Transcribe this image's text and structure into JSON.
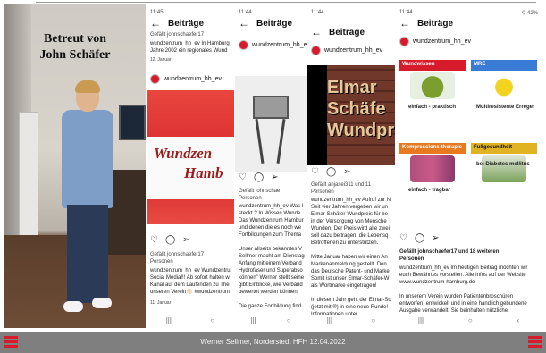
{
  "photo": {
    "caption_line1": "Betreut von",
    "caption_line2": "John Schäfer"
  },
  "phone1": {
    "status_time": "11:45",
    "title": "Beiträge",
    "liked_by": "Gefällt johnschaefer17",
    "account": "wundzentrum_hh_ev",
    "caption_line1": "wundzentrum_hh_ev In Hamburg",
    "caption_line2": "Jahre 2002 ein regionales Wund",
    "date": "12. Januar",
    "logo_line1": "Wundzen",
    "logo_line2": "Hamb",
    "liked_by2": "Gefällt johnschaefer17",
    "liked_by2b": "Personen",
    "text2": "wundzentrum_hh_ev Wundzentru\nSocial Media!!! Ab sofort halten w\nKanal auf dem Laufenden zu The\nunseren Verein👋🏻 #wundzentrum",
    "date2": "11. Januar"
  },
  "phone2": {
    "status_time": "11:44",
    "title": "Beiträge",
    "account": "wundzentrum_hh_ev",
    "liked_by": "Gefällt johnschae",
    "liked_by_b": "Personen",
    "text": "wundzentrum_hh_ev Was l\nsteckt ? In Wissen Wunde\nDas Wundzentrum Hambur\nund  denen die es noch we\nFortbildungen zum Thema\n\nUnser allseits bekanntes V\nSellmer macht am Dienstag\nAnfang mit einem Verband\nHydrofaser und Superabso\nkönnen\" Werner stellt seine\ngibt Einblicke, wie Verbänd\nbewertet werden können.\n\nDie ganze Fortbildung find"
  },
  "phone3": {
    "status_time": "11:44",
    "title": "Beiträge",
    "account": "wundzentrum_hh_ev",
    "image_word1": "Elmar",
    "image_word2": "Schäfe",
    "image_word3": "Wundpr",
    "liked_by": "Gefällt anjasei311 und 11",
    "liked_by_b": "Personen",
    "text": "wundzentrum_hh_ev Aufruf zur N\nSeit vier Jahren vergeben wir un\nElmar-Schäfer-Wundpreis für be\nin der Versorgung von Mensche\nWunden. Der Preis wird alle zwei\nsoll dazu beitragen, die Lebensq\nBetroffenen zu unterstützen.\n\nMitte Januar haben wir einen An\nMarkenanmeldung gestellt. Den\ndas Deutsche Patent- und Marke\nSomit ist unser Elmar-Schäfer-W\nals Wortmarke eingetragen!\n\nIn diesem Jahr geht der Elmar-Sc\n(jetzt mit ®) in eine neue Runde!\nInformationen unter"
  },
  "phone4": {
    "status_time": "11:44",
    "status_right": "⚲ 42%",
    "title": "Beiträge",
    "account": "wundzentrum_hh_ev",
    "tiles": [
      {
        "header": "Wundwissen",
        "caption": "einfach - praktisch"
      },
      {
        "header": "MRE",
        "caption": "Multiresistente Erreger"
      },
      {
        "header": "Kompressions-therapie",
        "caption": "einfach - tragbar"
      },
      {
        "header": "Fußgesundheit",
        "caption": "bei Diabetes mellitus"
      }
    ],
    "liked_by": "Gefällt johnschaefer17 und 18 weiteren",
    "liked_by_b": "Personen",
    "text": "wundzentrum_hh_ev Im heutigen Beitrag möchten wir\neuch Bewährtes vorstellen. Alle Infos auf der Website\nwww.wundzentrum-hamburg.de\n\nIn unserem Verein wurden Patientenbroschüren\nentworfen, entwickelt und in eine handlich gebundene\nAusgabe verwandelt. Sie beinhalten nützliche"
  },
  "footer": {
    "text": "Werner Sellmer, Norderstedt HFH 12.04.2022"
  },
  "colors": {
    "brand_red": "#d81b2b",
    "footer_gray": "#7f7f7f"
  }
}
